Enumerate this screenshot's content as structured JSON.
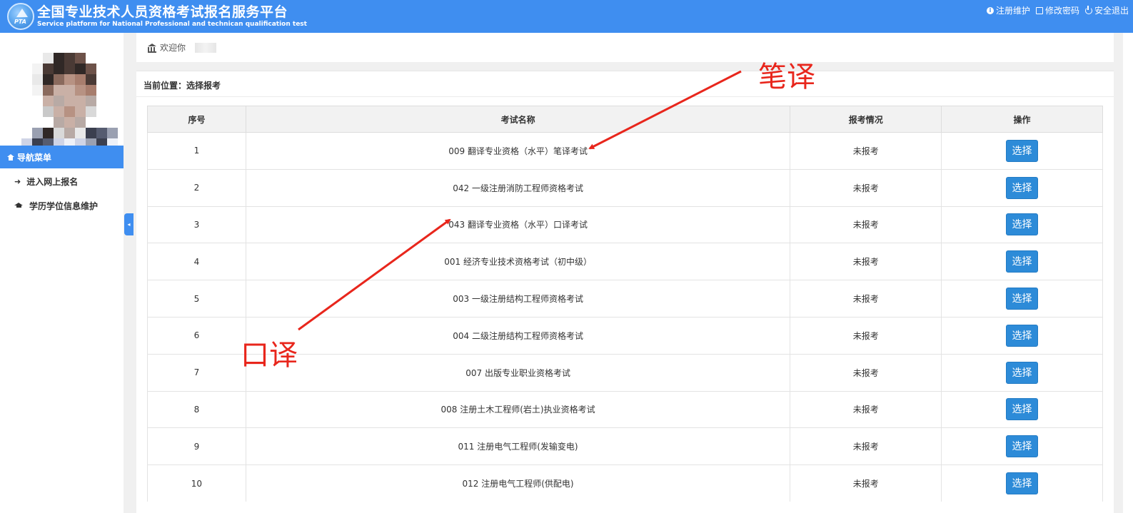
{
  "header": {
    "title": "全国专业技术人员资格考试报名服务平台",
    "subtitle": "Service platform for National Professional and technican qualification test",
    "logo_text": "PTA",
    "links": [
      {
        "label": "注册维护",
        "icon": "info-circle-icon"
      },
      {
        "label": "修改密码",
        "icon": "edit-icon"
      },
      {
        "label": "安全退出",
        "icon": "power-icon"
      }
    ]
  },
  "sidebar": {
    "nav_header": "导航菜单",
    "items": [
      {
        "label": "进入网上报名",
        "icon": "sign-in-icon"
      },
      {
        "label": "学历学位信息维护",
        "icon": "graduation-cap-icon"
      }
    ],
    "collapse_glyph": "◂"
  },
  "welcome": {
    "text": "欢迎你"
  },
  "breadcrumb": "当前位置：选择报考",
  "table": {
    "headers": [
      "序号",
      "考试名称",
      "报考情况",
      "操作"
    ],
    "rows": [
      {
        "no": "1",
        "name": "009 翻译专业资格（水平）笔译考试",
        "status": "未报考",
        "action": "选择"
      },
      {
        "no": "2",
        "name": "042 一级注册消防工程师资格考试",
        "status": "未报考",
        "action": "选择"
      },
      {
        "no": "3",
        "name": "043 翻译专业资格（水平）口译考试",
        "status": "未报考",
        "action": "选择"
      },
      {
        "no": "4",
        "name": "001 经济专业技术资格考试（初中级）",
        "status": "未报考",
        "action": "选择"
      },
      {
        "no": "5",
        "name": "003 一级注册结构工程师资格考试",
        "status": "未报考",
        "action": "选择"
      },
      {
        "no": "6",
        "name": "004 二级注册结构工程师资格考试",
        "status": "未报考",
        "action": "选择"
      },
      {
        "no": "7",
        "name": "007 出版专业职业资格考试",
        "status": "未报考",
        "action": "选择"
      },
      {
        "no": "8",
        "name": "008 注册土木工程师(岩土)执业资格考试",
        "status": "未报考",
        "action": "选择"
      },
      {
        "no": "9",
        "name": "011 注册电气工程师(发输变电)",
        "status": "未报考",
        "action": "选择"
      },
      {
        "no": "10",
        "name": "012 注册电气工程师(供配电)",
        "status": "未报考",
        "action": "选择"
      }
    ]
  },
  "annotations": {
    "written_label": "笔译",
    "oral_label": "口译",
    "color": "#e8261c"
  },
  "colors": {
    "header_bg": "#3f8ef0",
    "button_bg": "#2d8bd8"
  }
}
